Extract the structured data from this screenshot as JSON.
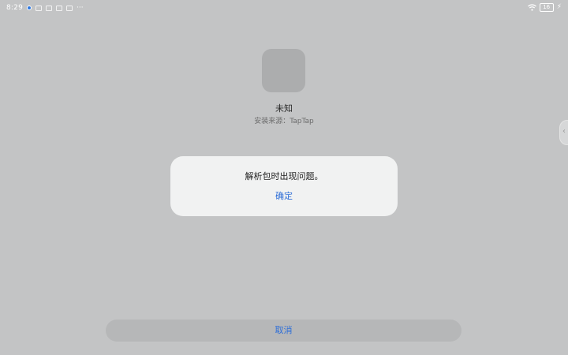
{
  "status_bar": {
    "time": "8:29",
    "battery": "16"
  },
  "app": {
    "name": "未知",
    "install_source": "安装来源：TapTap"
  },
  "dialog": {
    "message": "解析包时出现问题。",
    "confirm_label": "确定"
  },
  "footer": {
    "cancel_label": "取消"
  },
  "colors": {
    "background": "#c3c4c5",
    "dialog": "#f1f2f2",
    "accent": "#2f6fd8"
  }
}
